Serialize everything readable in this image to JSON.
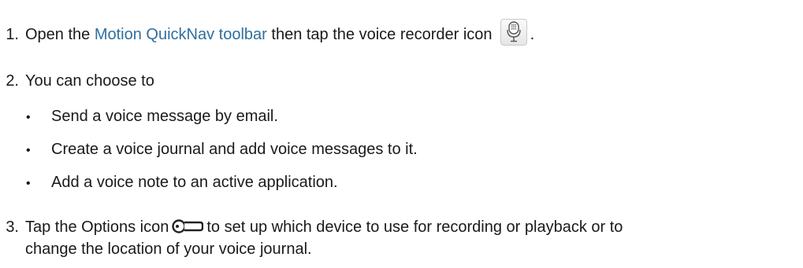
{
  "steps": [
    {
      "number": "1.",
      "text_before_link": "Open the ",
      "link_text": "Motion QuickNav toolbar",
      "text_after_link": " then tap the voice recorder icon",
      "text_end": "."
    },
    {
      "number": "2.",
      "text": "You can choose to",
      "bullets": [
        "Send a voice message by email.",
        "Create a voice journal and add voice messages to it.",
        "Add a voice note to an active application."
      ]
    },
    {
      "number": "3.",
      "text_before_icon": "Tap the Options icon",
      "text_after_icon": "to set up which device to use for recording or playback or to",
      "text_line2": "change the location of your voice journal."
    }
  ],
  "icons": {
    "voice_recorder": "microphone-icon",
    "options": "key-icon"
  },
  "colors": {
    "link": "#2f6f9f",
    "text": "#1a1a1a"
  }
}
